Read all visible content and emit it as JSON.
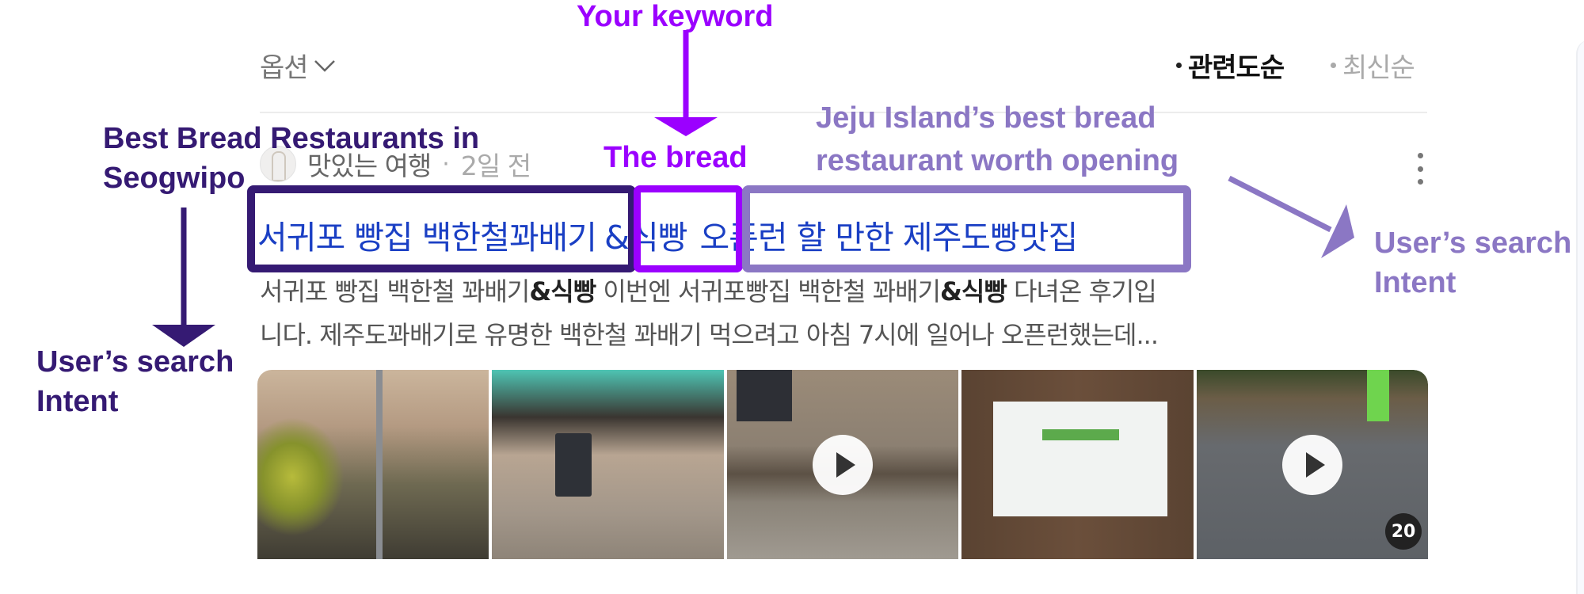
{
  "toolbar": {
    "options_label": "옵션",
    "sort_options": [
      {
        "label": "관련도순",
        "selected": true
      },
      {
        "label": "최신순",
        "selected": false
      }
    ]
  },
  "result": {
    "author": "맛있는 여행",
    "separator": "·",
    "time": "2일 전",
    "title_parts": [
      "서귀포 빵집 백한철꽈배기",
      "&식빵",
      "오픈런 할 만한 제주도빵맛집"
    ],
    "snippet_line1": {
      "pre": "서귀포 빵집 백한철 꽈배기",
      "bold1": "&식빵",
      "mid": " 이번엔 서귀포빵집 백한철 꽈배기",
      "bold2": "&식빵",
      "post": " 다녀온 후기입"
    },
    "snippet_line2": "니다. 제주도꽈배기로 유명한 백한철 꽈배기 먹으려고 아침 7시에 일어나 오픈런했는데...",
    "images": [
      {
        "name": "tree-street-photo",
        "video": false
      },
      {
        "name": "bakery-entrance-photo",
        "video": false
      },
      {
        "name": "stone-path-video",
        "video": true
      },
      {
        "name": "opening-hours-sign-photo",
        "video": false
      },
      {
        "name": "road-video",
        "video": true
      }
    ],
    "image_count": "20"
  },
  "annotations": {
    "your_keyword": "Your keyword",
    "the_bread": "The bread",
    "best_bread_line1": "Best Bread Restaurants in",
    "best_bread_line2": "Seogwipo",
    "intent_left_line1": "User’s search",
    "intent_left_line2": "Intent",
    "jeju_line1": "Jeju Island’s best bread",
    "jeju_line2": "restaurant worth opening",
    "intent_right_line1": "User’s search",
    "intent_right_line2": "Intent",
    "colors": {
      "dark": "#351a73",
      "keyword": "#9b00ff",
      "light": "#8b77c4"
    }
  }
}
